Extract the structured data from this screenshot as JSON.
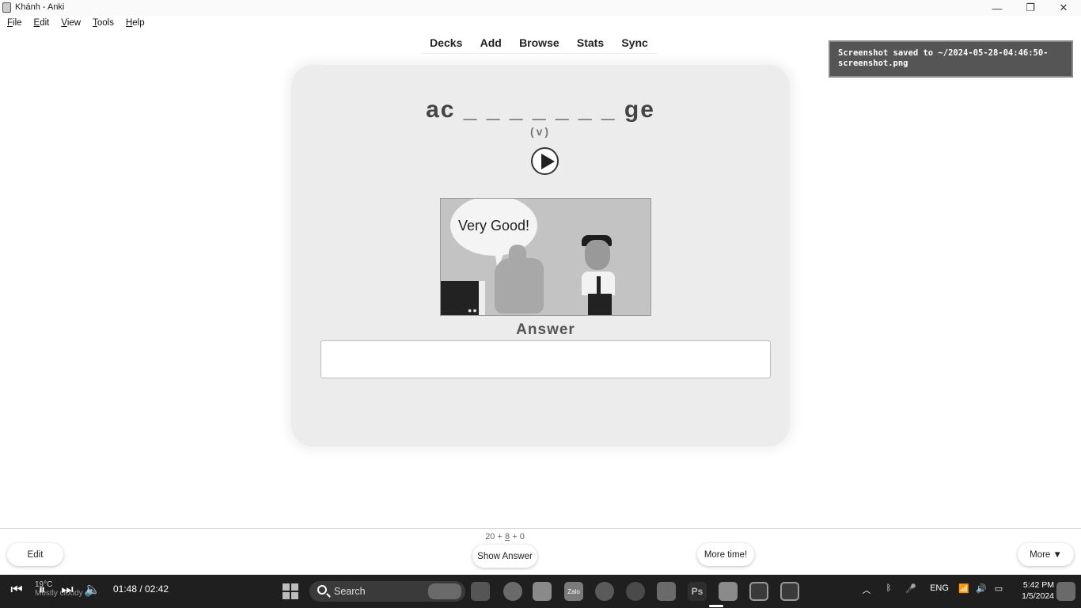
{
  "window": {
    "title": "Khánh - Anki",
    "minimize_glyph": "—",
    "maximize_glyph": "❐",
    "close_glyph": "✕"
  },
  "menubar": {
    "items": [
      "File",
      "Edit",
      "View",
      "Tools",
      "Help"
    ]
  },
  "topnav": {
    "items": [
      "Decks",
      "Add",
      "Browse",
      "Stats",
      "Sync"
    ]
  },
  "toast": {
    "line1": "Screenshot saved to ~/2024-05-28-04:46:50-",
    "line2": "screenshot.png"
  },
  "card": {
    "word": "ac _ _ _ _ _ _ _ ge",
    "part_of_speech": "(v)",
    "image_text": "Very Good!",
    "answer_label": "Answer",
    "answer_value": ""
  },
  "bottom": {
    "count_new": "20",
    "count_learn": "8",
    "count_review": "0",
    "plus": "+",
    "edit_label": "Edit",
    "show_answer_label": "Show Answer",
    "more_time_label": "More time!",
    "more_label": "More ▼"
  },
  "taskbar": {
    "media_prev": "⏮",
    "media_pause": "⏸",
    "media_next": "⏭",
    "media_volume": "🔈",
    "weather_temp": "19°C",
    "weather_desc": "Mostly cloudy",
    "time_elapsed": "01:48 / 02:42",
    "search_label": "Search",
    "zalo_label": "Zalo",
    "ps_label": "Ps",
    "language": "ENG",
    "clock_time": "5:42 PM",
    "clock_date": "1/5/2024"
  }
}
